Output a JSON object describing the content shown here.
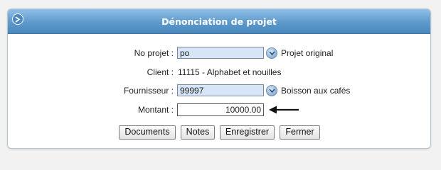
{
  "title": "Dénonciation de projet",
  "form": {
    "no_projet": {
      "label": "No projet :",
      "value": "po",
      "description": "Projet original"
    },
    "client": {
      "label": "Client :",
      "value": "11115 - Alphabet et nouilles"
    },
    "fournisseur": {
      "label": "Fournisseur :",
      "value": "99997",
      "description": "Boisson aux cafés"
    },
    "montant": {
      "label": "Montant :",
      "value": "10000.00"
    }
  },
  "buttons": {
    "documents": "Documents",
    "notes": "Notes",
    "enregistrer": "Enregistrer",
    "fermer": "Fermer"
  },
  "icons": {
    "collapse": "collapse-arrow-icon",
    "dropdown": "chevron-down-circle-icon",
    "annotation_arrow": "left-arrow-icon"
  },
  "colors": {
    "title_bar": "#5e99cb",
    "input_background": "#d6e6f8"
  }
}
